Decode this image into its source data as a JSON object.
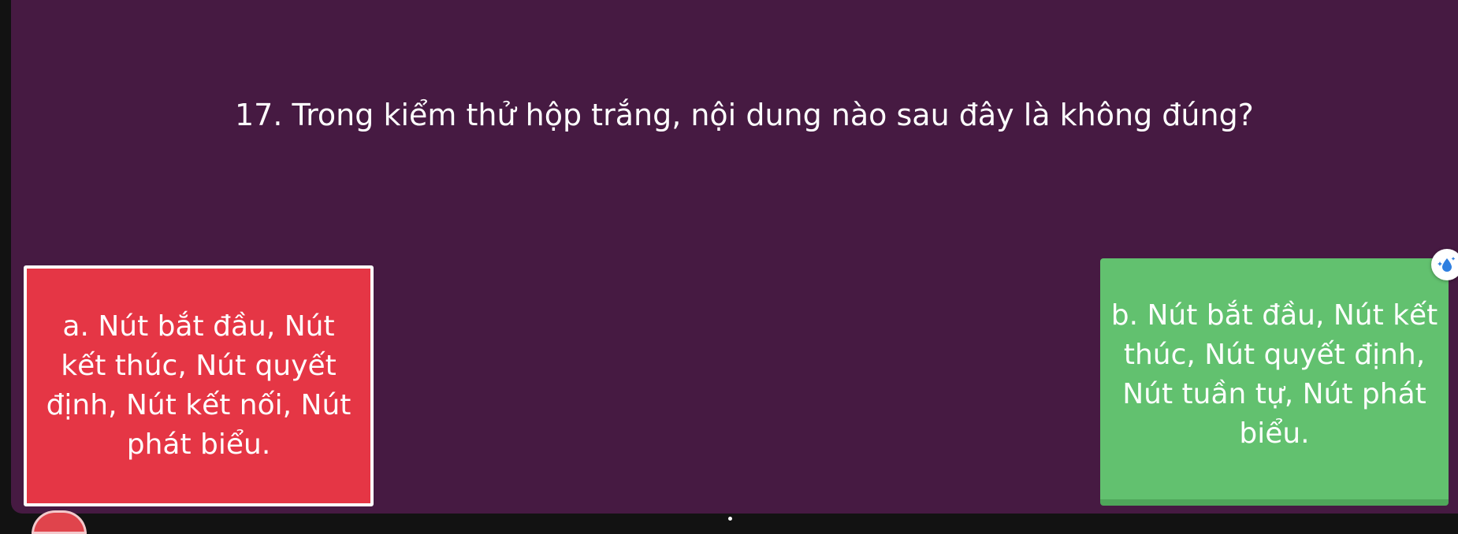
{
  "question": {
    "text": "17.  Trong kiểm thử hộp trắng, nội dung nào sau đây là không đúng?"
  },
  "answers": [
    {
      "label": "a.      Nút bắt đầu, Nút kết thúc, Nút quyết định, Nút kết nối, Nút phát biểu.",
      "color": "#e53645",
      "selected": true
    },
    {
      "label": "b.      Nút bắt đầu, Nút kết thúc, Nút quyết định, Nút tuần tự, Nút phát biểu.",
      "color": "#62c16f",
      "selected": false
    }
  ],
  "background_color": "#461a42",
  "badge_icon": "sparkle-droplet-icon"
}
